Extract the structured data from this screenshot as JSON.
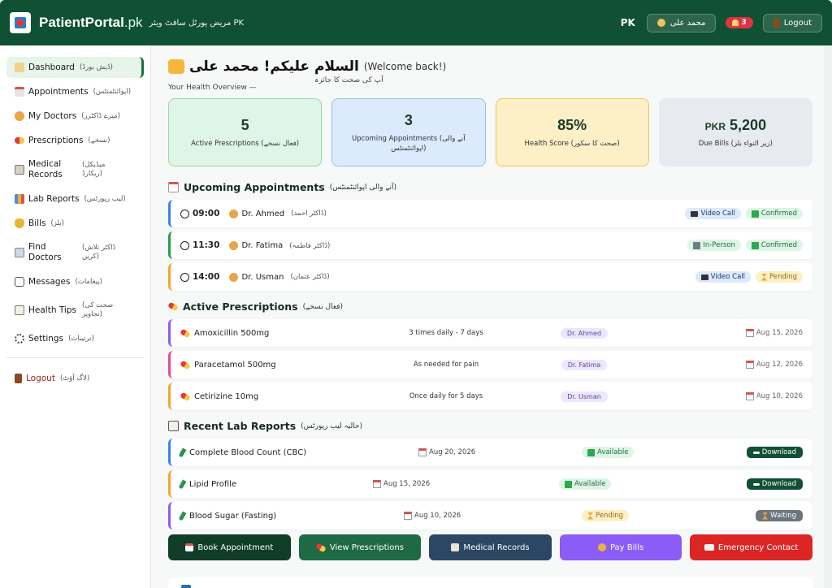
{
  "header": {
    "brand_bold": "PatientPortal",
    "brand_light": ".pk",
    "brand_urdu": "مریض پورٹل سافٹ ویئر PK",
    "country": "PK",
    "user_name": "محمد علی",
    "notif_count": "3",
    "logout_label": "Logout"
  },
  "sidebar": {
    "items": [
      {
        "label": "Dashboard",
        "urdu": "(ڈیش بورڈ)",
        "icon": "home-icon"
      },
      {
        "label": "Appointments",
        "urdu": "(اپوائنٹمنٹس)",
        "icon": "calendar-icon"
      },
      {
        "label": "My Doctors",
        "urdu": "(میرے ڈاکٹرز)",
        "icon": "doctor-icon"
      },
      {
        "label": "Prescriptions",
        "urdu": "(نسخے)",
        "icon": "pill-icon"
      },
      {
        "label": "Medical Records",
        "urdu": "(میڈیکل ریکارڈ)",
        "icon": "clipboard-icon"
      },
      {
        "label": "Lab Reports",
        "urdu": "(لیب رپورٹس)",
        "icon": "chart-icon"
      },
      {
        "label": "Bills",
        "urdu": "(بلز)",
        "icon": "moneybag-icon"
      },
      {
        "label": "Find Doctors",
        "urdu": "(ڈاکٹر تلاش کریں)",
        "icon": "hospital-icon"
      },
      {
        "label": "Messages",
        "urdu": "(پیغامات)",
        "icon": "message-icon"
      },
      {
        "label": "Health Tips",
        "urdu": "(صحت کی تجاویز)",
        "icon": "note-icon"
      },
      {
        "label": "Settings",
        "urdu": "(ترتیبات)",
        "icon": "gear-icon"
      }
    ],
    "logout": {
      "label": "Logout",
      "urdu": "(لاگ آؤٹ)"
    }
  },
  "welcome": {
    "name_urdu": "السلام علیکم! محمد علی",
    "en": "(Welcome back!)",
    "sub_urdu": "آپ کی صحت کا جائزہ",
    "sub_en": "Your Health Overview —"
  },
  "stats": [
    {
      "value": "5",
      "caption": "Active Prescriptions (فعال نسخے)"
    },
    {
      "value": "3",
      "caption": "Upcoming Appointments (آنے والی اپوائنٹمنٹس)"
    },
    {
      "value": "85%",
      "caption": "Health Score (صحت کا سکور)"
    },
    {
      "value_prefix": "PKR",
      "value": "5,200",
      "caption": "Due Bills (زیر التواء بلز)"
    }
  ],
  "appointments": {
    "title": "Upcoming Appointments",
    "title_urdu": "(آنے والی اپوائنٹمنٹس)",
    "rows": [
      {
        "time": "09:00",
        "doctor": "Dr. Ahmed",
        "doctor_urdu": "(ڈاکٹر احمد)",
        "mode": "Video Call",
        "status": "Confirmed"
      },
      {
        "time": "11:30",
        "doctor": "Dr. Fatima",
        "doctor_urdu": "(ڈاکٹر فاطمہ)",
        "mode": "In-Person",
        "status": "Confirmed"
      },
      {
        "time": "14:00",
        "doctor": "Dr. Usman",
        "doctor_urdu": "(ڈاکٹر عثمان)",
        "mode": "Video Call",
        "status": "Pending"
      }
    ]
  },
  "prescriptions": {
    "title": "Active Prescriptions",
    "title_urdu": "(فعال نسخے)",
    "rows": [
      {
        "name": "Amoxicillin 500mg",
        "freq": "3 times daily - 7 days",
        "doctor": "Dr. Ahmed",
        "date": "Aug 15, 2026"
      },
      {
        "name": "Paracetamol 500mg",
        "freq": "As needed for pain",
        "doctor": "Dr. Fatima",
        "date": "Aug 12, 2026"
      },
      {
        "name": "Cetirizine 10mg",
        "freq": "Once daily for 5 days",
        "doctor": "Dr. Usman",
        "date": "Aug 10, 2026"
      }
    ]
  },
  "labs": {
    "title": "Recent Lab Reports",
    "title_urdu": "(حالیہ لیب رپورٹس)",
    "rows": [
      {
        "name": "Complete Blood Count (CBC)",
        "date": "Aug 20, 2026",
        "status": "Available",
        "action": "Download"
      },
      {
        "name": "Lipid Profile",
        "date": "Aug 15, 2026",
        "status": "Available",
        "action": "Download"
      },
      {
        "name": "Blood Sugar (Fasting)",
        "date": "Aug 10, 2026",
        "status": "Pending",
        "action": "Waiting"
      }
    ]
  },
  "actions": [
    "Book Appointment",
    "View Prescriptions",
    "Medical Records",
    "Pay Bills",
    "Emergency Contact"
  ],
  "colors": {
    "primary": "#0f5132",
    "accent_blue": "#3b82f6",
    "accent_green": "#22a04b",
    "accent_amber": "#f0a92b",
    "accent_purple": "#8b5cf6",
    "accent_pink": "#e6499a",
    "danger": "#dc2626"
  }
}
